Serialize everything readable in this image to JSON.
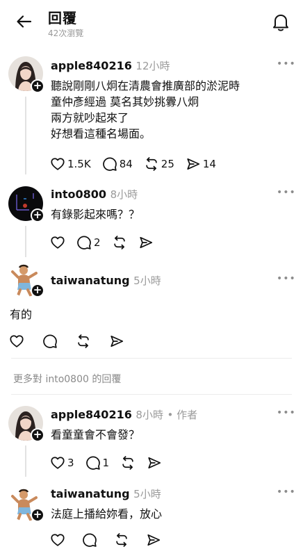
{
  "header": {
    "title": "回覆",
    "views": "42次瀏覽"
  },
  "icons": {
    "back": "arrow-left-icon",
    "bell": "bell-icon",
    "more": "more-horizontal-icon",
    "like": "heart-icon",
    "reply": "comment-icon",
    "repost": "repost-icon",
    "share": "send-icon"
  },
  "posts": [
    {
      "username": "apple840216",
      "time": "12小時",
      "lines": [
        "聽說剛剛八炯在清農會推廣部的淤泥時",
        "童仲彥經過 莫名其妙挑釁八炯",
        "兩方就吵起來了",
        "好想看這種名場面。"
      ],
      "likes": "1.5K",
      "replies": "84",
      "reposts": "25",
      "shares": "14"
    },
    {
      "username": "into0800",
      "time": "8小時",
      "lines": [
        "有錄影起來嗎？？"
      ],
      "likes": "",
      "replies": "2",
      "reposts": "",
      "shares": ""
    },
    {
      "username": "taiwanatung",
      "time": "5小時",
      "lines": [
        "有的"
      ],
      "likes": "",
      "replies": "",
      "reposts": "",
      "shares": ""
    }
  ],
  "more_replies_label": "更多對 into0800 的回覆",
  "replies": [
    {
      "username": "apple840216",
      "time": "8小時",
      "author_tag": "• 作者",
      "lines": [
        "看童童會不會發？"
      ],
      "likes": "3",
      "replies": "1",
      "reposts": "",
      "shares": ""
    },
    {
      "username": "taiwanatung",
      "time": "5小時",
      "lines": [
        "法庭上播給妳看，放心"
      ],
      "likes": "",
      "replies": "",
      "reposts": "",
      "shares": ""
    }
  ]
}
